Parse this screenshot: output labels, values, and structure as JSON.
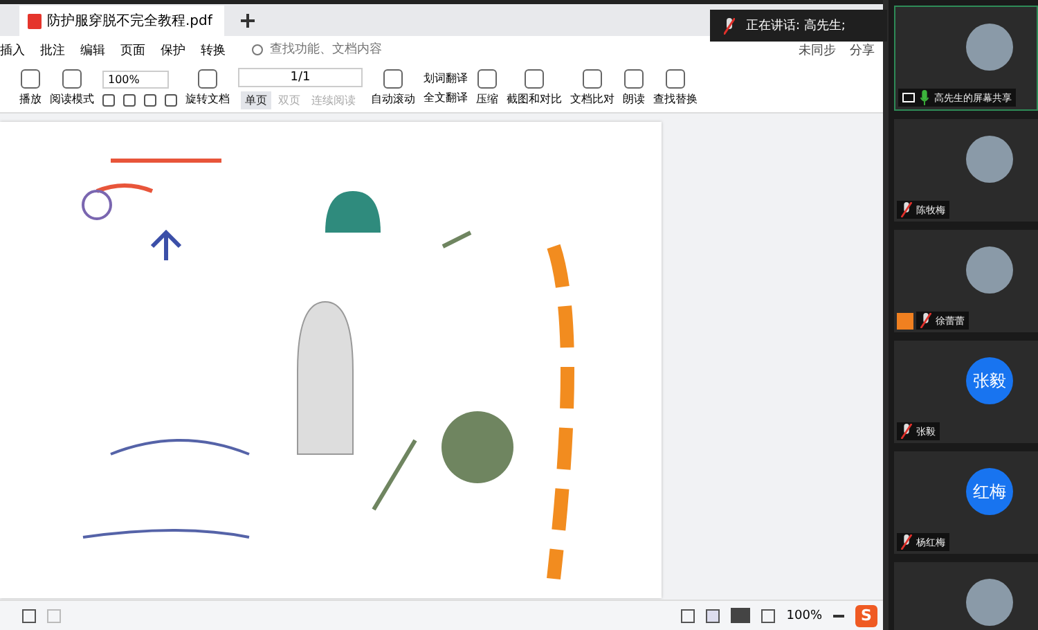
{
  "tab": {
    "title": "防护服穿脱不完全教程.pdf"
  },
  "menu": [
    "插入",
    "批注",
    "编辑",
    "页面",
    "保护",
    "转换"
  ],
  "search": {
    "placeholder": "查找功能、文档内容"
  },
  "sync": [
    "未同步",
    "分享"
  ],
  "toolbar": [
    {
      "label": "播放",
      "kind": "big"
    },
    {
      "label": "阅读模式",
      "kind": "big"
    },
    {
      "label": "100%",
      "kind": "zoom"
    },
    {
      "label": "旋转文档",
      "kind": "big"
    },
    {
      "label": "单页",
      "kind": "small",
      "selected": true
    },
    {
      "label": "双页",
      "kind": "small",
      "selected": false
    },
    {
      "label": "连续阅读",
      "kind": "small",
      "selected": false
    },
    {
      "label": "自动滚动",
      "kind": "big"
    },
    {
      "label": "划词翻译",
      "kind": "pair",
      "second": "全文翻译"
    },
    {
      "label": "压缩",
      "kind": "big"
    },
    {
      "label": "截图和对比",
      "kind": "big"
    },
    {
      "label": "文档比对",
      "kind": "big"
    },
    {
      "label": "朗读",
      "kind": "big"
    },
    {
      "label": "查找替换",
      "kind": "big"
    }
  ],
  "page_field": "1/1",
  "status_bar": {
    "zoom": "100%",
    "input_method": "S"
  },
  "speaking": "正在讲话: 高先生;",
  "participants": [
    {
      "name": "高先生的屏幕共享",
      "kind": "photo",
      "muted": false,
      "sharing": true
    },
    {
      "name": "陈牧梅",
      "kind": "photo",
      "muted": true,
      "sharing": false
    },
    {
      "name": "徐蕾蕾",
      "kind": "photo",
      "muted": true,
      "sharing": false
    },
    {
      "name": "张毅",
      "kind": "text",
      "initials": "张毅",
      "muted": true,
      "sharing": false
    },
    {
      "name": "杨红梅",
      "kind": "text",
      "initials": "红梅",
      "muted": true,
      "sharing": false
    },
    {
      "kind": "photo"
    }
  ]
}
